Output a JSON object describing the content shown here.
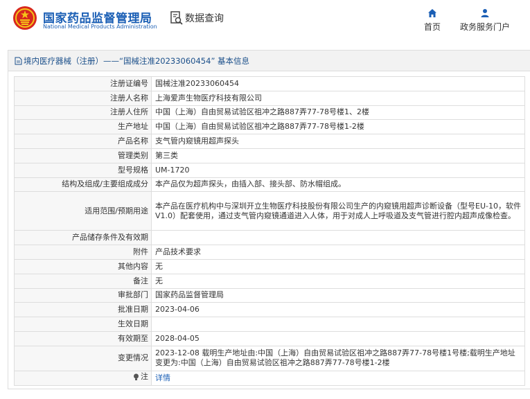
{
  "header": {
    "site_name_cn": "国家药品监督管理局",
    "site_name_en": "National Medical Products Administration",
    "query_label": "数据查询",
    "nav": [
      {
        "label": "首页",
        "icon": "home-icon"
      },
      {
        "label": "政务服务门户",
        "icon": "user-icon"
      }
    ]
  },
  "panel": {
    "title": "境内医疗器械（注册）——“国械注准20233060454” 基本信息"
  },
  "rows": [
    {
      "key": "注册证编号",
      "value": "国械注准20233060454"
    },
    {
      "key": "注册人名称",
      "value": "上海爱声生物医疗科技有限公司"
    },
    {
      "key": "注册人住所",
      "value": "中国（上海）自由贸易试验区祖冲之路887弄77-78号楼1、2楼"
    },
    {
      "key": "生产地址",
      "value": "中国（上海）自由贸易试验区祖冲之路887弄77-78号楼1-2楼"
    },
    {
      "key": "产品名称",
      "value": "支气管内窥镜用超声探头"
    },
    {
      "key": "管理类别",
      "value": "第三类"
    },
    {
      "key": "型号规格",
      "value": "UM-1720"
    },
    {
      "key": "结构及组成/主要组成成分",
      "value": "本产品仅为超声探头，由插入部、接头部、防水帽组成。"
    },
    {
      "key": "适用范围/预期用途",
      "value": "本产品在医疗机构中与深圳开立生物医疗科技股份有限公司生产的内窥镜用超声诊断设备（型号EU-10，软件V1.0）配套使用，通过支气管内窥镜通道进入人体，用于对成人上呼吸道及支气管进行腔内超声成像检查。"
    },
    {
      "key": "产品储存条件及有效期",
      "value": ""
    },
    {
      "key": "附件",
      "value": "产品技术要求"
    },
    {
      "key": "其他内容",
      "value": "无"
    },
    {
      "key": "备注",
      "value": "无"
    },
    {
      "key": "审批部门",
      "value": "国家药品监督管理局"
    },
    {
      "key": "批准日期",
      "value": "2023-04-06"
    },
    {
      "key": "生效日期",
      "value": ""
    },
    {
      "key": "有效期至",
      "value": "2028-04-05"
    },
    {
      "key": "变更情况",
      "value": "2023-12-08 载明生产地址由:中国（上海）自由贸易试验区祖冲之路887弄77-78号楼1号楼;载明生产地址变更为:中国（上海）自由贸易试验区祖冲之路887弄77-78号楼1-2楼"
    },
    {
      "key": "注",
      "value": "详情"
    }
  ]
}
